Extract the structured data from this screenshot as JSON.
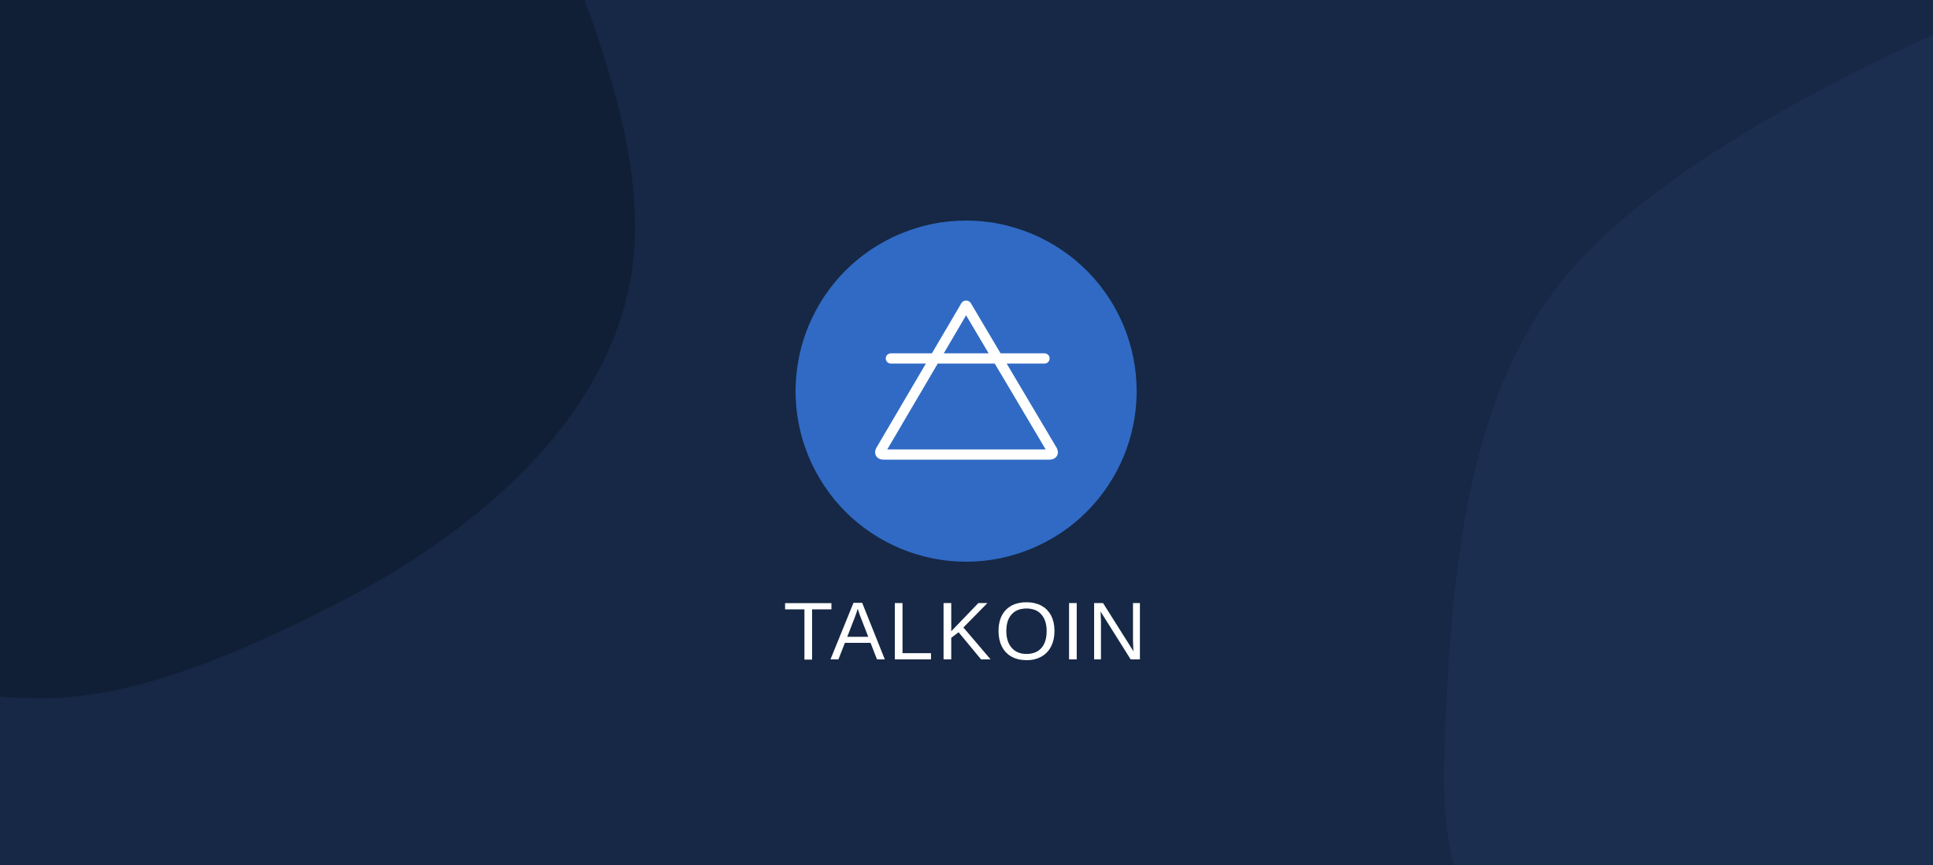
{
  "brand": {
    "name": "TALKOIN",
    "logo_icon": "triangle-with-bar-icon"
  },
  "colors": {
    "background": "#162845",
    "shape_dark": "#111f36",
    "shape_light": "#1c2e50",
    "accent": "#306ac4",
    "text": "#ffffff"
  }
}
